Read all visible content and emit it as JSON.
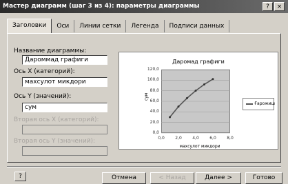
{
  "window": {
    "title": "Мастер диаграмм (шаг 3 из 4): параметры диаграммы",
    "help_glyph": "?",
    "close_glyph": "×"
  },
  "tabs": [
    {
      "label": "Заголовки",
      "active": true
    },
    {
      "label": "Оси"
    },
    {
      "label": "Линии сетки"
    },
    {
      "label": "Легенда"
    },
    {
      "label": "Подписи данных"
    }
  ],
  "form": {
    "chart_name_label": "Название диаграммы:",
    "chart_name_value": "Дароммад графиги",
    "x_axis_label": "Ось X (категорий):",
    "x_axis_value": "махсулот микдори",
    "y_axis_label": "Ось Y (значений):",
    "y_axis_value": "сум",
    "second_x_label": "Вторая ось X (категорий):",
    "second_y_label": "Вторая ось Y (значений):"
  },
  "chart_data": {
    "type": "line",
    "title": "Даромад графиги",
    "xlabel": "махсулот микдори",
    "ylabel": "сум",
    "x_ticks": [
      "0,0",
      "2,0",
      "4,0",
      "6,0",
      "8,0"
    ],
    "y_ticks": [
      "0,0",
      "20,0",
      "40,0",
      "60,0",
      "80,0",
      "100,0",
      "120,0"
    ],
    "xlim": [
      0,
      8
    ],
    "ylim": [
      0,
      120
    ],
    "series": [
      {
        "name": "Ғарожиш",
        "x": [
          1,
          2,
          3,
          4,
          5,
          6
        ],
        "values": [
          30,
          50,
          66,
          80,
          92,
          102
        ]
      }
    ],
    "legend_position": "right"
  },
  "buttons": {
    "help": "?",
    "cancel": "Отмена",
    "back": "< Назад",
    "next": "Далее >",
    "finish": "Готово"
  },
  "colors": {
    "window_bg": "#d4d0c8",
    "titlebar": "#4a4a4a",
    "series_line": "#555555"
  }
}
